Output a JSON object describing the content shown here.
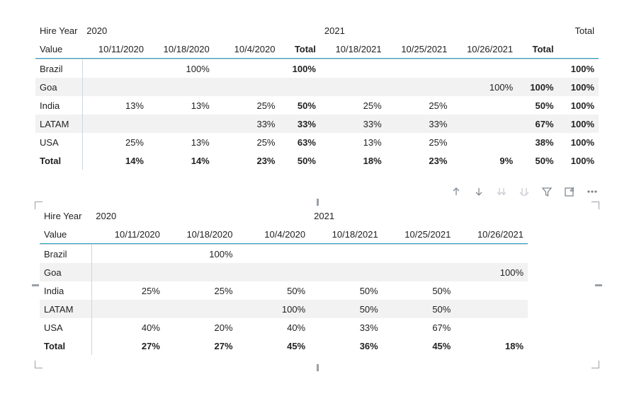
{
  "labels": {
    "hire_year": "Hire Year",
    "value": "Value",
    "total": "Total"
  },
  "matrix1": {
    "years": [
      "2020",
      "2021"
    ],
    "cols_2020": [
      "10/11/2020",
      "10/18/2020",
      "10/4/2020"
    ],
    "cols_2021": [
      "10/18/2021",
      "10/25/2021",
      "10/26/2021"
    ],
    "rows": [
      {
        "label": "Brazil",
        "y2020": [
          "",
          "100%",
          ""
        ],
        "sub2020": "100%",
        "y2021": [
          "",
          "",
          ""
        ],
        "sub2021": "",
        "total": "100%"
      },
      {
        "label": "Goa",
        "y2020": [
          "",
          "",
          ""
        ],
        "sub2020": "",
        "y2021": [
          "",
          "",
          "100%"
        ],
        "sub2021": "100%",
        "total": "100%"
      },
      {
        "label": "India",
        "y2020": [
          "13%",
          "13%",
          "25%"
        ],
        "sub2020": "50%",
        "y2021": [
          "25%",
          "25%",
          ""
        ],
        "sub2021": "50%",
        "total": "100%"
      },
      {
        "label": "LATAM",
        "y2020": [
          "",
          "",
          "33%"
        ],
        "sub2020": "33%",
        "y2021": [
          "33%",
          "33%",
          ""
        ],
        "sub2021": "67%",
        "total": "100%"
      },
      {
        "label": "USA",
        "y2020": [
          "25%",
          "13%",
          "25%"
        ],
        "sub2020": "63%",
        "y2021": [
          "13%",
          "25%",
          ""
        ],
        "sub2021": "38%",
        "total": "100%"
      },
      {
        "label": "Total",
        "y2020": [
          "14%",
          "14%",
          "23%"
        ],
        "sub2020": "50%",
        "y2021": [
          "18%",
          "23%",
          "9%"
        ],
        "sub2021": "50%",
        "total": "100%"
      }
    ]
  },
  "matrix2": {
    "years": [
      "2020",
      "2021"
    ],
    "cols_2020": [
      "10/11/2020",
      "10/18/2020",
      "10/4/2020"
    ],
    "cols_2021": [
      "10/18/2021",
      "10/25/2021",
      "10/26/2021"
    ],
    "rows": [
      {
        "label": "Brazil",
        "y2020": [
          "",
          "100%",
          ""
        ],
        "y2021": [
          "",
          "",
          ""
        ]
      },
      {
        "label": "Goa",
        "y2020": [
          "",
          "",
          ""
        ],
        "y2021": [
          "",
          "",
          "100%"
        ]
      },
      {
        "label": "India",
        "y2020": [
          "25%",
          "25%",
          "50%"
        ],
        "y2021": [
          "50%",
          "50%",
          ""
        ]
      },
      {
        "label": "LATAM",
        "y2020": [
          "",
          "",
          "100%"
        ],
        "y2021": [
          "50%",
          "50%",
          ""
        ]
      },
      {
        "label": "USA",
        "y2020": [
          "40%",
          "20%",
          "40%"
        ],
        "y2021": [
          "33%",
          "67%",
          ""
        ]
      },
      {
        "label": "Total",
        "y2020": [
          "27%",
          "27%",
          "45%"
        ],
        "y2021": [
          "36%",
          "45%",
          "18%"
        ]
      }
    ]
  }
}
